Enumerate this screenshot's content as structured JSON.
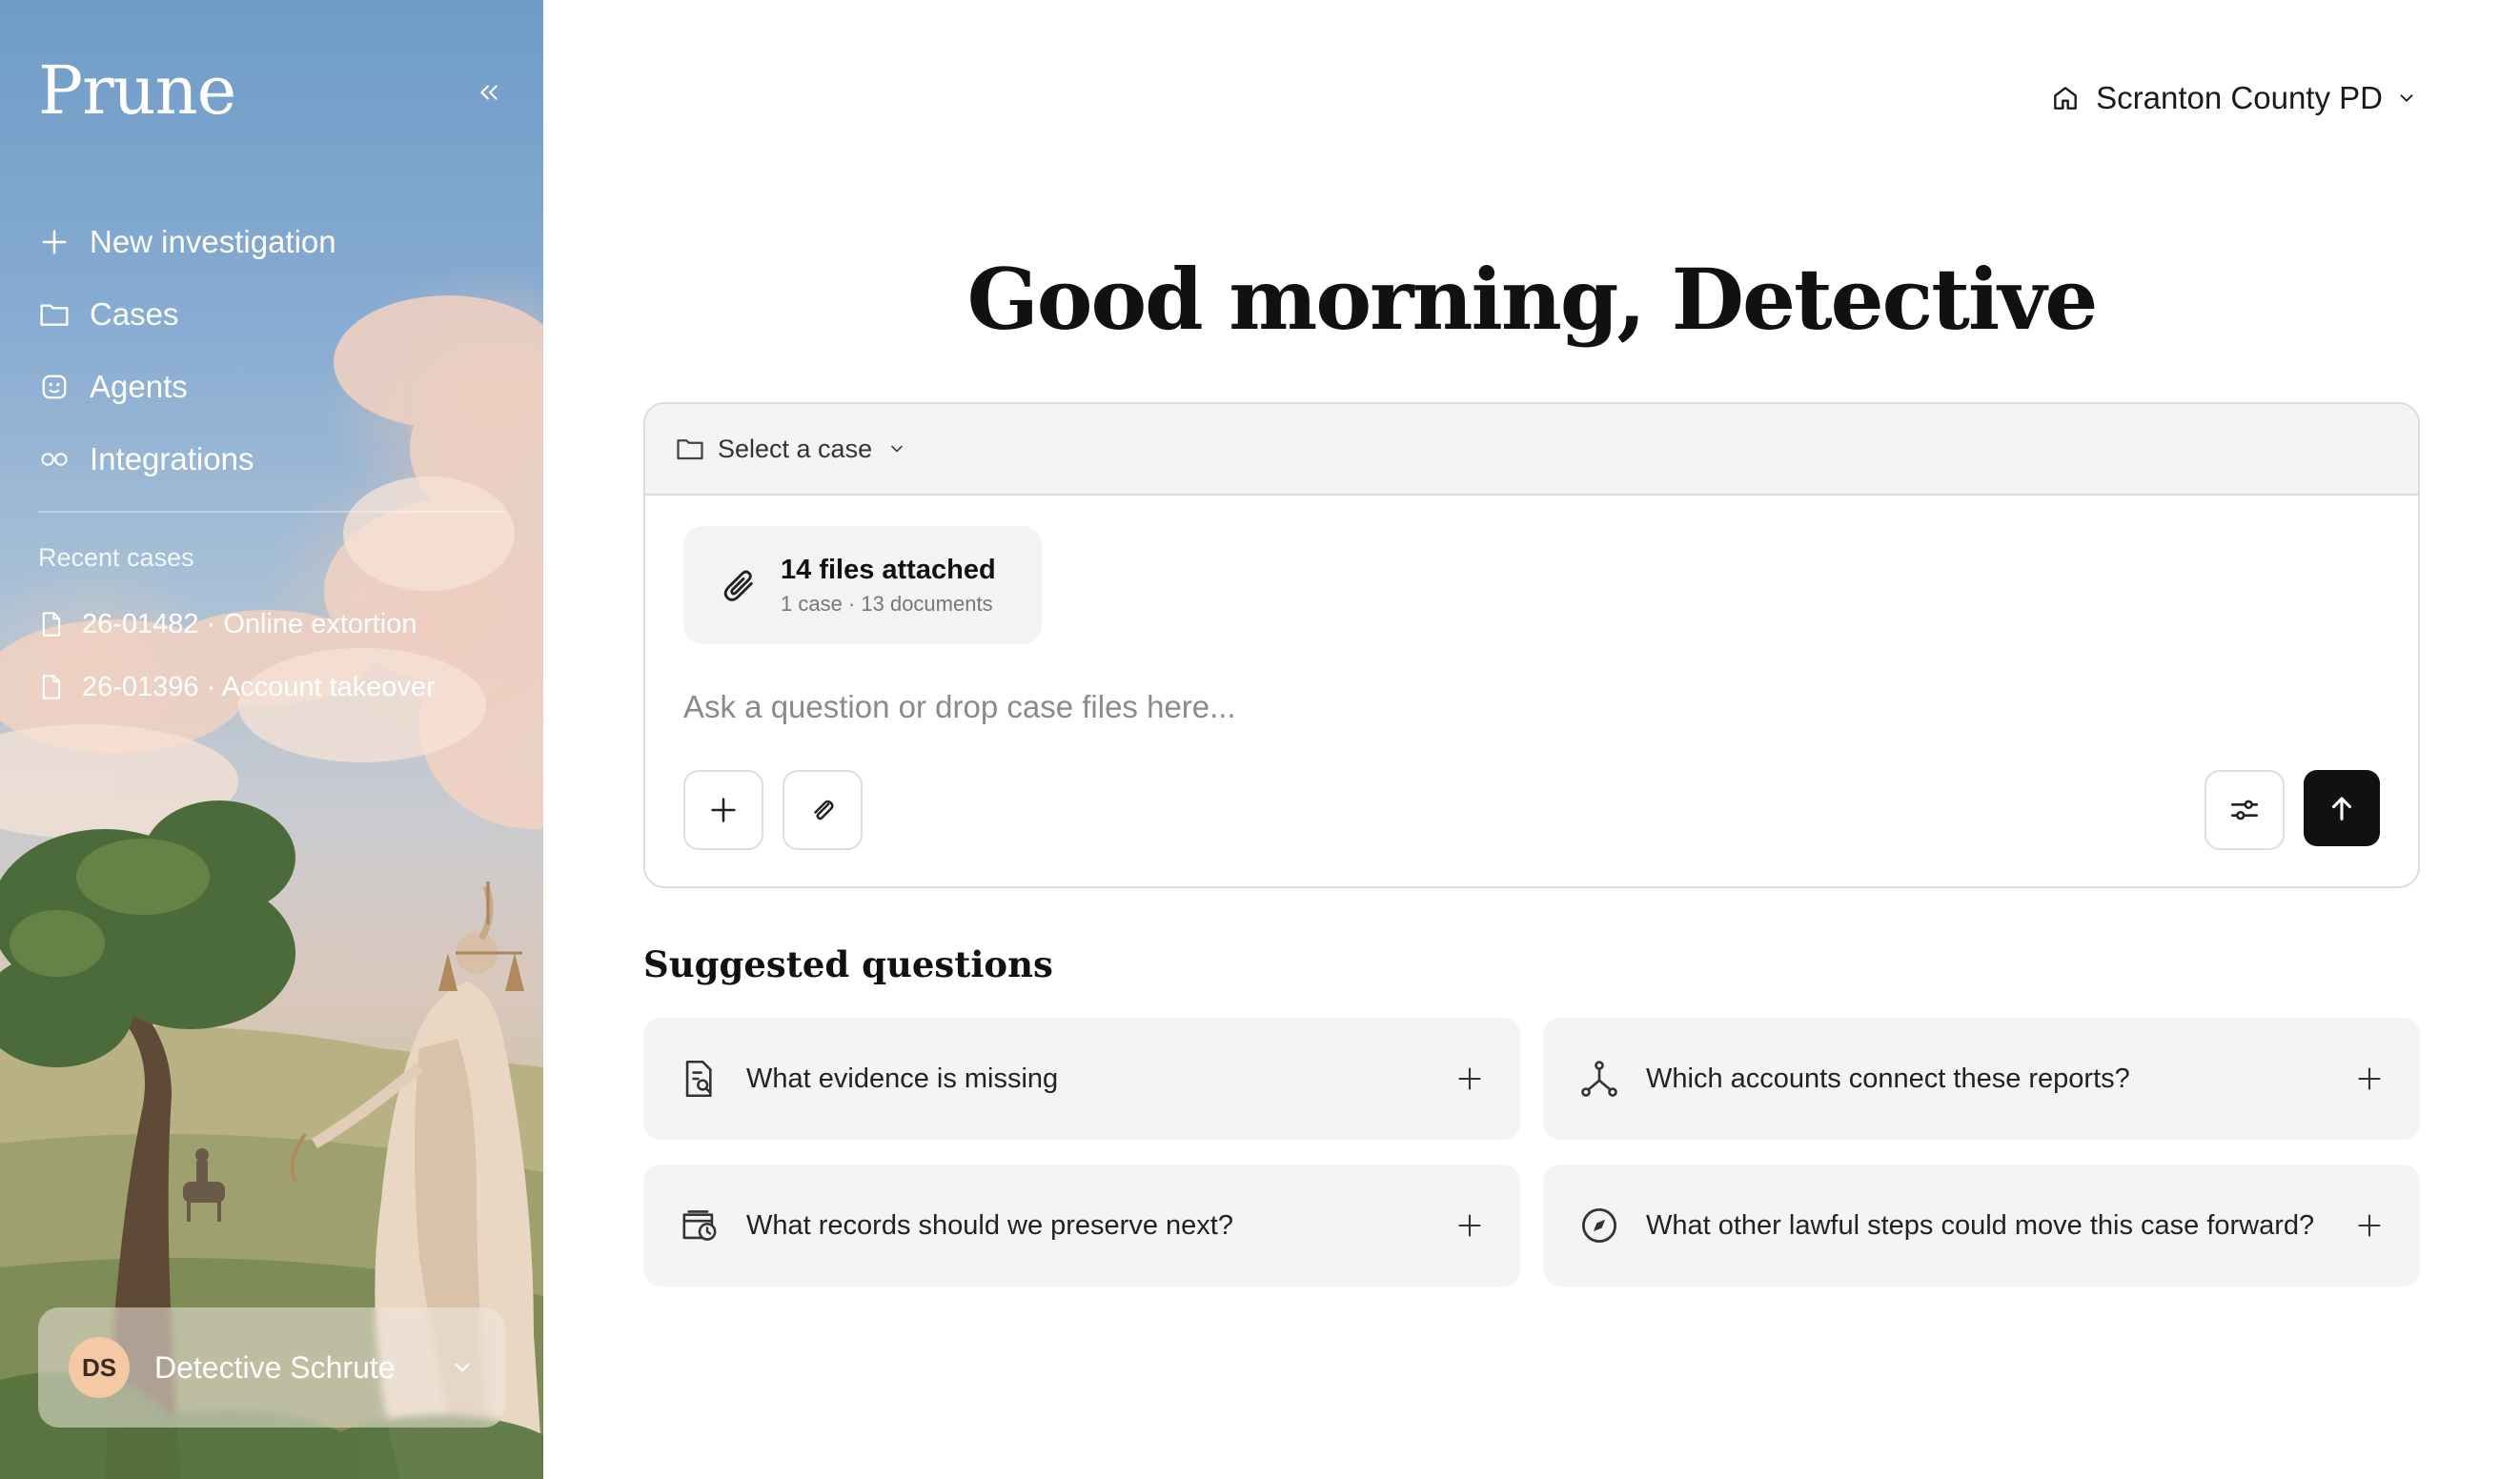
{
  "app": {
    "logo": "Prune"
  },
  "sidebar": {
    "nav": [
      {
        "label": "New investigation",
        "icon": "plus-icon"
      },
      {
        "label": "Cases",
        "icon": "folder-icon"
      },
      {
        "label": "Agents",
        "icon": "agent-face-icon"
      },
      {
        "label": "Integrations",
        "icon": "infinity-icon"
      }
    ],
    "recent_label": "Recent cases",
    "recent": [
      {
        "label": "26-01482 · Online extortion",
        "icon": "file-icon"
      },
      {
        "label": "26-01396 · Account takeover",
        "icon": "file-icon"
      }
    ],
    "user": {
      "initials": "DS",
      "name": "Detective Schrute"
    }
  },
  "header": {
    "org": "Scranton County PD"
  },
  "main": {
    "greeting": "Good morning, Detective",
    "composer": {
      "case_select": "Select a case",
      "attachment": {
        "title": "14 files attached",
        "subtitle": "1 case · 13 documents"
      },
      "placeholder": "Ask a question or drop case files here..."
    },
    "suggested_title": "Suggested questions",
    "suggestions": [
      {
        "text": "What evidence is missing",
        "icon": "document-search-icon"
      },
      {
        "text": "Which accounts connect these reports?",
        "icon": "network-icon"
      },
      {
        "text": "What records should we preserve next?",
        "icon": "archive-clock-icon"
      },
      {
        "text": "What other lawful steps could move this case forward?",
        "icon": "compass-icon"
      }
    ]
  },
  "colors": {
    "accent": "#111111",
    "card_bg": "#f4f4f4",
    "border": "#dcdcdc",
    "avatar": "#f3c9a6"
  }
}
